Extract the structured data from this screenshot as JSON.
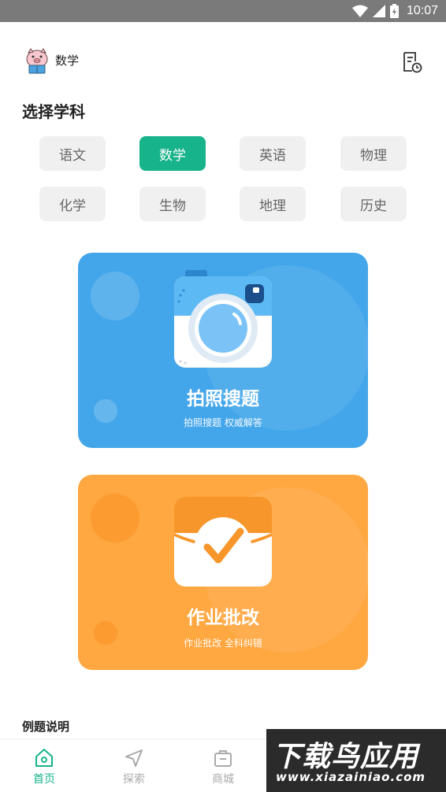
{
  "status_bar": {
    "time": "10:07"
  },
  "header": {
    "current_subject": "数学"
  },
  "section_title": "选择学科",
  "subjects": [
    {
      "label": "语文",
      "active": false
    },
    {
      "label": "数学",
      "active": true
    },
    {
      "label": "英语",
      "active": false
    },
    {
      "label": "物理",
      "active": false
    },
    {
      "label": "化学",
      "active": false
    },
    {
      "label": "生物",
      "active": false
    },
    {
      "label": "地理",
      "active": false
    },
    {
      "label": "历史",
      "active": false
    }
  ],
  "cards": {
    "photo_search": {
      "title": "拍照搜题",
      "subtitle": "拍照搜题 权威解答"
    },
    "homework_check": {
      "title": "作业批改",
      "subtitle": "作业批改 全科纠错"
    }
  },
  "example_title": "例题说明",
  "bottom_nav": [
    {
      "label": "首页",
      "icon": "home-icon",
      "active": true
    },
    {
      "label": "探索",
      "icon": "navigate-icon",
      "active": false
    },
    {
      "label": "商城",
      "icon": "shop-icon",
      "active": false
    }
  ],
  "watermark": {
    "main": "下载鸟应用",
    "url": "www.xiazainiao.com"
  },
  "colors": {
    "accent": "#17b38a",
    "blue_card": "#44a6ea",
    "orange_card": "#ffa740",
    "chip_bg": "#f0f0f0"
  }
}
